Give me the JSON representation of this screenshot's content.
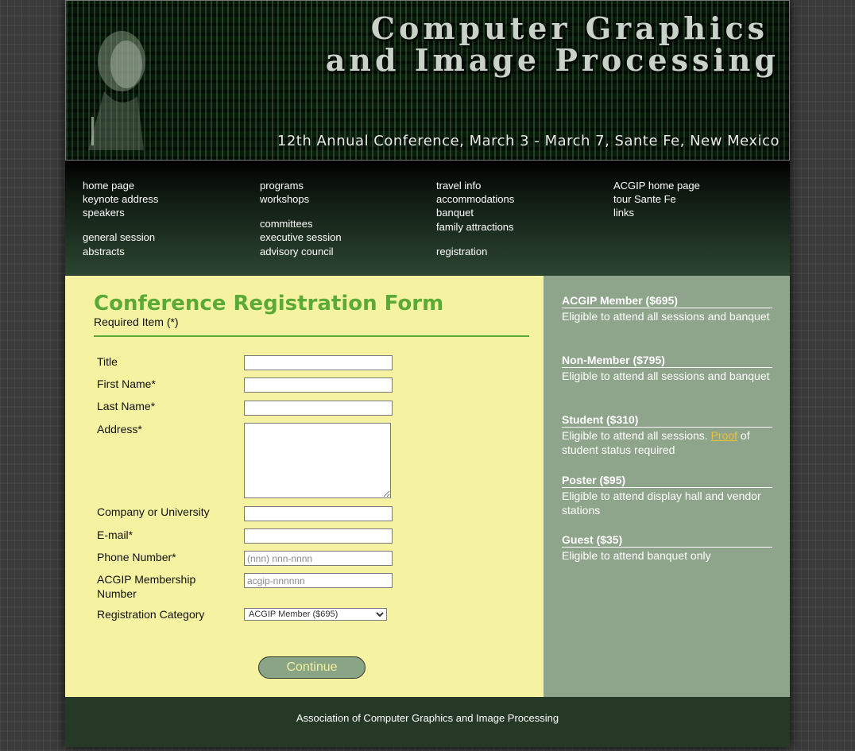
{
  "banner": {
    "title_line1": "Computer Graphics",
    "title_line2": "and Image Processing",
    "subtitle": "12th Annual Conference, March 3 - March 7, Sante Fe, New Mexico"
  },
  "nav": {
    "col1": [
      "home page",
      "keynote address",
      "speakers",
      "general session",
      "abstracts"
    ],
    "col2": [
      "programs",
      "workshops",
      "committees",
      "executive session",
      "advisory council"
    ],
    "col3": [
      "travel info",
      "accommodations",
      "banquet",
      "family attractions",
      "registration"
    ],
    "col4": [
      "ACGIP home page",
      "tour Sante Fe",
      "links"
    ]
  },
  "form": {
    "title": "Conference Registration Form",
    "required_note": "Required Item (*)",
    "labels": {
      "title": "Title",
      "first_name": "First Name*",
      "last_name": "Last Name*",
      "address": "Address*",
      "company": "Company or University",
      "email": "E-mail*",
      "phone": "Phone Number*",
      "membership": "ACGIP Membership Number",
      "category": "Registration Category"
    },
    "values": {
      "title": "",
      "first_name": "",
      "last_name": "",
      "address": "",
      "company": "",
      "email": "",
      "phone": "",
      "membership": ""
    },
    "placeholders": {
      "phone": "(nnn) nnn-nnnn",
      "membership": "acgip-nnnnnn"
    },
    "category_selected": "ACGIP Member ($695)",
    "continue_label": "Continue"
  },
  "sidebar": {
    "categories": [
      {
        "name": "ACGIP Member ($695)",
        "desc": "Eligible to attend all sessions and banquet"
      },
      {
        "name": "Non-Member ($795)",
        "desc": "Eligible to attend all sessions and banquet"
      },
      {
        "name": "Student ($310)",
        "desc_before": "Eligible to attend all sessions. ",
        "link": "Proof",
        "desc_after": " of student status required"
      },
      {
        "name": "Poster ($95)",
        "desc": "Eligible to attend display hall and vendor stations"
      },
      {
        "name": "Guest ($35)",
        "desc": "Eligible to attend banquet only"
      }
    ]
  },
  "footer": {
    "text": "Association of Computer Graphics and Image Processing"
  },
  "colors": {
    "form_title": "#5aaa35",
    "main_bg": "#f5f3a2",
    "sidebar_bg": "#8fa58b",
    "link_accent": "#e8c33a",
    "footer_bg": "#263927"
  }
}
